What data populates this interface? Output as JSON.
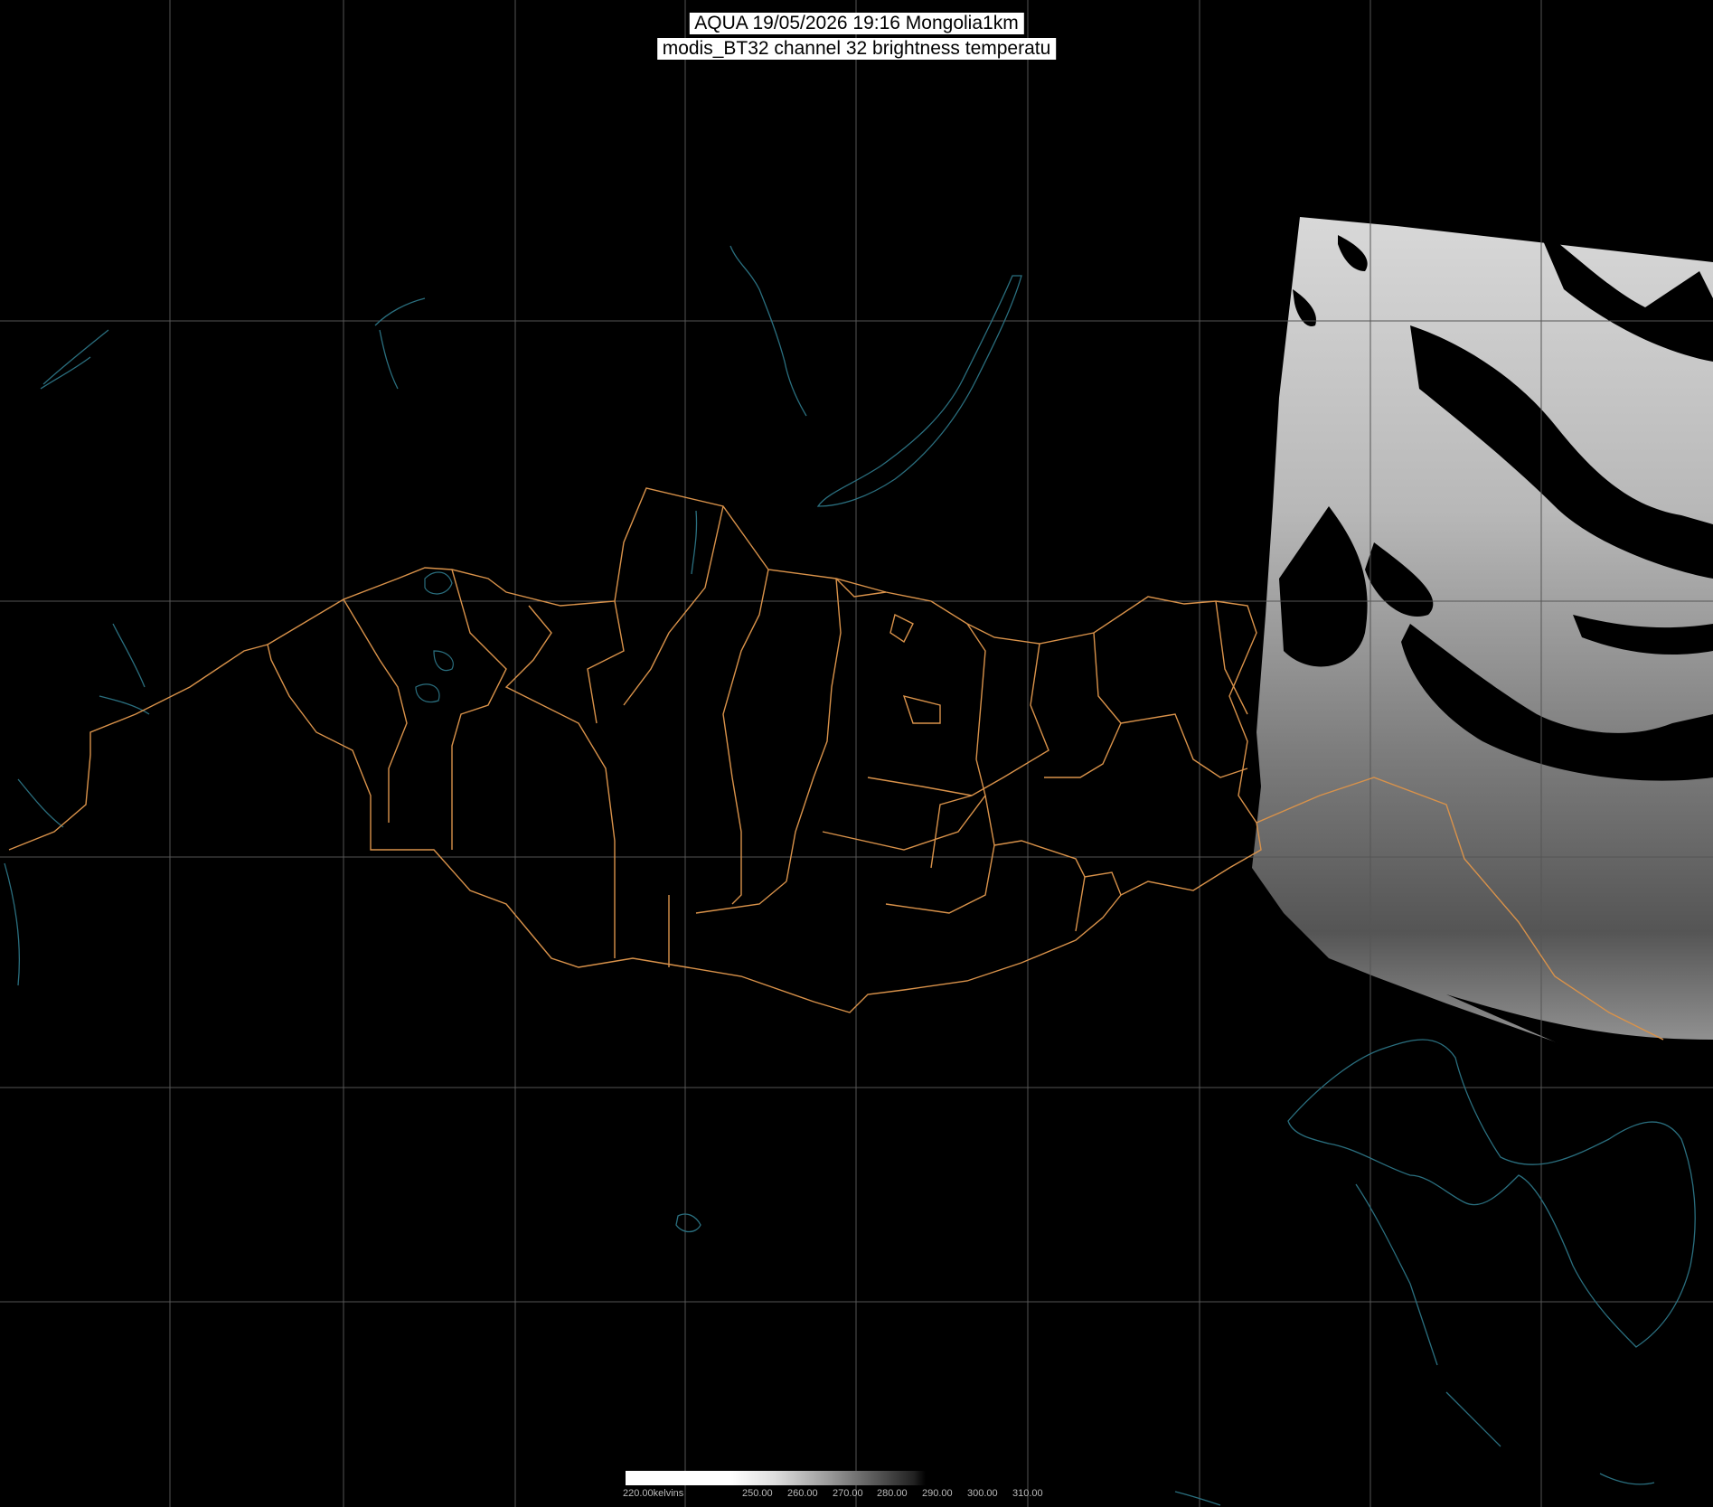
{
  "title": {
    "line1": "AQUA 19/05/2026 19:16 Mongolia1km",
    "line2": "modis_BT32 channel 32 brightness temperatu"
  },
  "legend": {
    "labels": [
      "220.00kelvins",
      "250.00",
      "260.00",
      "270.00",
      "280.00",
      "290.00",
      "300.00",
      "310.00"
    ]
  },
  "colors": {
    "background": "#000000",
    "grid": "#555555",
    "borders": "#d9924a",
    "coast": "#2a6f7f"
  }
}
